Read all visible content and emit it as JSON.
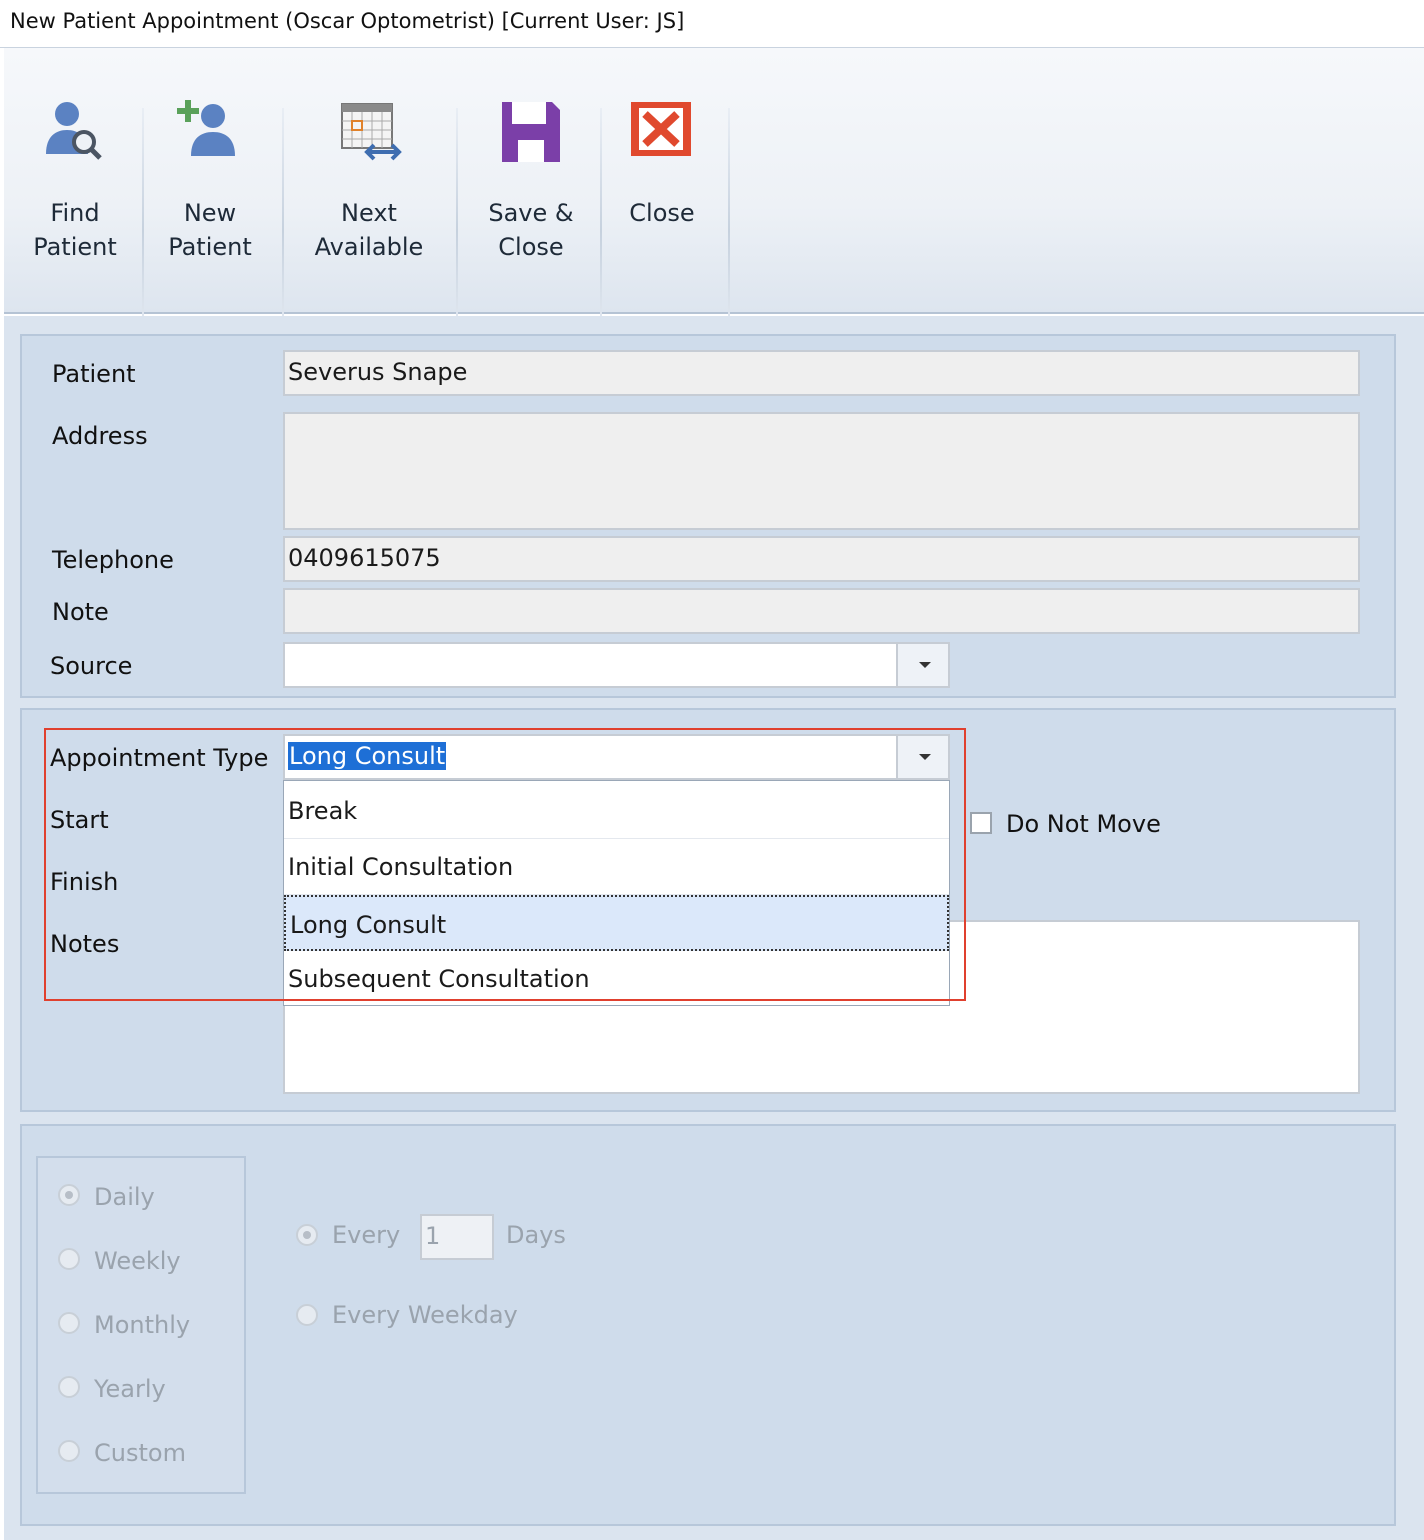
{
  "window": {
    "title": "New Patient Appointment (Oscar Optometrist) [Current User: JS]"
  },
  "toolbar": {
    "find_patient": "Find\nPatient",
    "new_patient": "New\nPatient",
    "next_available": "Next\nAvailable",
    "save_close": "Save &\nClose",
    "close": "Close"
  },
  "patient_panel": {
    "patient_label": "Patient",
    "patient_value": "Severus Snape",
    "address_label": "Address",
    "address_value": "",
    "telephone_label": "Telephone",
    "telephone_value": "0409615075",
    "note_label": "Note",
    "note_value": "",
    "source_label": "Source",
    "source_value": ""
  },
  "appointment_panel": {
    "type_label": "Appointment Type",
    "type_value": "Long Consult",
    "start_label": "Start",
    "finish_label": "Finish",
    "notes_label": "Notes",
    "do_not_move_label": "Do Not Move",
    "type_options": [
      "Break",
      "Initial Consultation",
      "Long Consult",
      "Subsequent Consultation"
    ],
    "selected_option": "Long Consult"
  },
  "recurrence_panel": {
    "frequencies": [
      "Daily",
      "Weekly",
      "Monthly",
      "Yearly",
      "Custom"
    ],
    "selected_frequency": "Daily",
    "every_label": "Every",
    "every_value": "1",
    "days_label": "Days",
    "every_weekday_label": "Every Weekday"
  }
}
